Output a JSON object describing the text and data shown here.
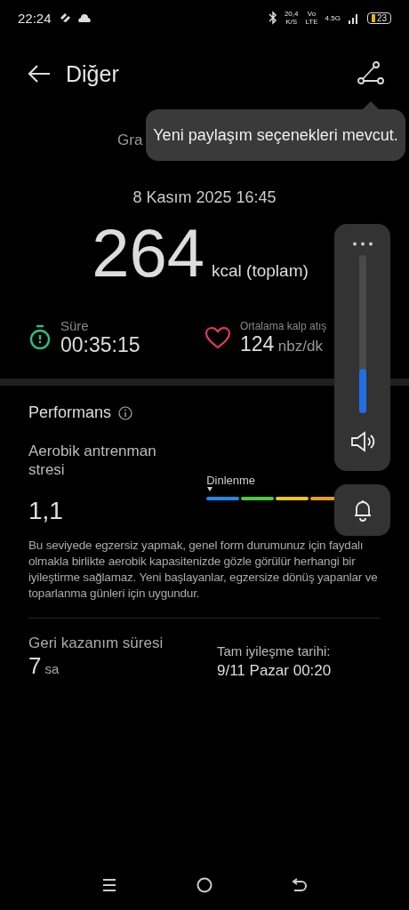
{
  "status_bar": {
    "time": "22:24",
    "net_speed": "20,4",
    "net_unit": "K/S",
    "volte": "Vo",
    "lte": "LTE",
    "network": "4.5G",
    "battery": "23"
  },
  "header": {
    "title": "Diğer"
  },
  "tooltip": {
    "text": "Yeni paylaşım seçenekleri mevcut."
  },
  "subtitle": "Gra",
  "date": "8 Kasım 2025 16:45",
  "calories": {
    "value": "264",
    "unit": "kcal (toplam)"
  },
  "stats": [
    {
      "kind": "timer",
      "label": "Süre",
      "value": "00:35:15"
    },
    {
      "kind": "heart",
      "label": "Ortalama kalp atış",
      "value": "124",
      "unit": "nbz/dk"
    }
  ],
  "performance": {
    "title": "Performans",
    "metric_label": "Aerobik antrenman stresi",
    "metric_value": "1,1",
    "scale_label": "Dinlenme",
    "description": "Bu seviyede egzersiz yapmak, genel form durumunuz için faydalı olmakla birlikte aerobik kapasitenizde gözle görülür herhangi bir iyileştirme sağlamaz. Yeni başlayanlar, egzersize dönüş yapanlar ve toparlanma günleri için uygundur."
  },
  "recovery": {
    "label": "Geri kazanım süresi",
    "value": "7",
    "unit": "sa",
    "full_label": "Tam iyileşme tarihi:",
    "full_value": "9/11 Pazar 00:20"
  },
  "volume": {
    "level": 0.28
  }
}
